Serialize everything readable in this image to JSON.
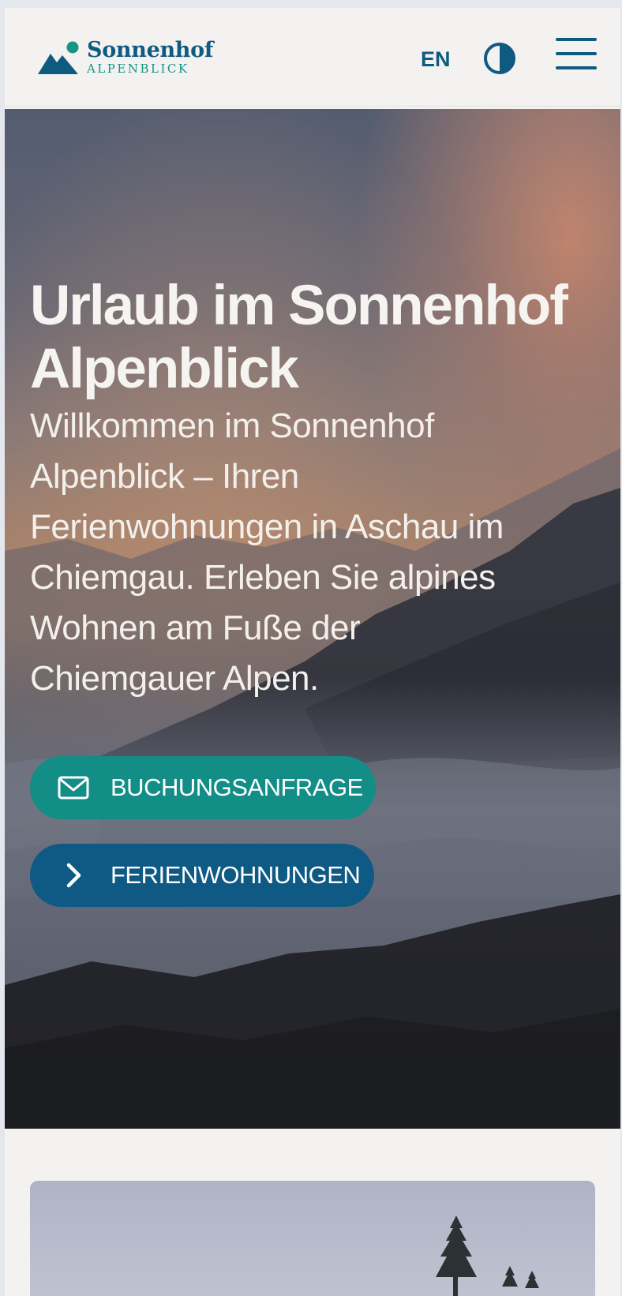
{
  "header": {
    "logo": {
      "name": "Sonnenhof",
      "subtitle": "ALPENBLICK"
    },
    "language_label": "EN",
    "contrast_icon": "contrast-icon",
    "menu_icon": "hamburger-menu-icon"
  },
  "hero": {
    "title": "Urlaub im Sonnenhof Alpenblick",
    "text": "Willkommen im Sonnenhof Alpenblick – Ihren Ferienwohnungen in Aschau im Chiemgau. Erleben Sie alpines Wohnen am Fuße der Chiemgauer Alpen.",
    "buttons": {
      "booking_label": "BUCHUNGSANFRAGE",
      "booking_icon": "envelope-icon",
      "apartments_label": "FERIENWOHNUNGEN",
      "apartments_icon": "chevron-right-icon"
    }
  },
  "colors": {
    "brand_blue": "#0f5a80",
    "brand_teal": "#179486",
    "button_teal": "#128e86",
    "button_blue": "#0e5a85",
    "page_background": "#f3f2f0"
  }
}
